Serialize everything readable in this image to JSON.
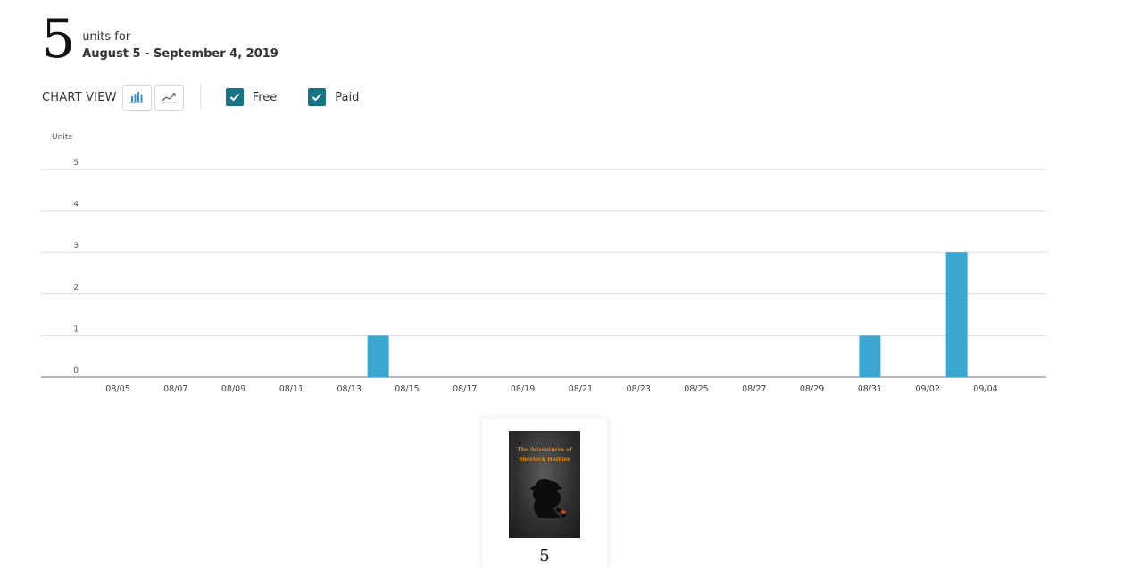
{
  "summary": {
    "total_units": "5",
    "units_for_label": "units for",
    "date_range": "August 5 - September 4, 2019"
  },
  "controls": {
    "chart_view_label": "CHART VIEW",
    "bar_view_icon": "bar-chart-icon",
    "line_view_icon": "line-chart-icon",
    "filters": [
      {
        "label": "Free",
        "checked": true
      },
      {
        "label": "Paid",
        "checked": true
      }
    ],
    "checkbox_color": "#177486"
  },
  "chart_data": {
    "type": "bar",
    "ylabel": "Units",
    "ylim": [
      0,
      5
    ],
    "yticks": [
      0,
      1,
      2,
      3,
      4,
      5
    ],
    "grid": true,
    "bar_color": "#3aa7d1",
    "xtick_labels": [
      "08/05",
      "08/07",
      "08/09",
      "08/11",
      "08/13",
      "08/15",
      "08/17",
      "08/19",
      "08/21",
      "08/23",
      "08/25",
      "08/27",
      "08/29",
      "08/31",
      "09/02",
      "09/04"
    ],
    "categories": [
      "08/05",
      "08/06",
      "08/07",
      "08/08",
      "08/09",
      "08/10",
      "08/11",
      "08/12",
      "08/13",
      "08/14",
      "08/15",
      "08/16",
      "08/17",
      "08/18",
      "08/19",
      "08/20",
      "08/21",
      "08/22",
      "08/23",
      "08/24",
      "08/25",
      "08/26",
      "08/27",
      "08/28",
      "08/29",
      "08/30",
      "08/31",
      "09/01",
      "09/02",
      "09/03",
      "09/04"
    ],
    "values": [
      0,
      0,
      0,
      0,
      0,
      0,
      0,
      0,
      0,
      1,
      0,
      0,
      0,
      0,
      0,
      0,
      0,
      0,
      0,
      0,
      0,
      0,
      0,
      0,
      0,
      0,
      1,
      0,
      0,
      3,
      0
    ]
  },
  "product": {
    "cover_title": "The Adventures of Sherlock Holmes",
    "units": "5"
  }
}
